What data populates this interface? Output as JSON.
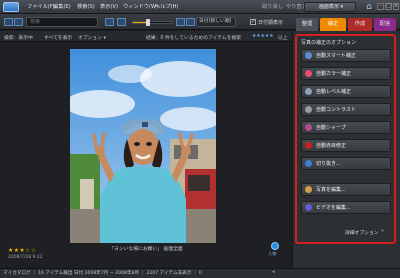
{
  "menu": [
    "ファイル(F)",
    "編集(E)",
    "検索(S)",
    "表示(V)",
    "ウィンドウ(W)",
    "ヘルプ(H)"
  ],
  "undo_label": "取り消し",
  "redo_label": "やり直し",
  "quick_button": "画面表示 ▾",
  "search": {
    "placeholder": "検索"
  },
  "toolbar": {
    "sort_label": "日付(新しい順)",
    "date_checkbox_label": "日付順表示"
  },
  "tabs": [
    "整理",
    "補正",
    "作成",
    "配信"
  ],
  "filter": {
    "search_label": "検索：表示中",
    "show_all": "すべてを表示",
    "options": "オプション ▾",
    "result_text": "結果：0 件をしているためのアイテムを検索",
    "more": "以上"
  },
  "photo": {
    "caption": "「ヨシいな場にお願い」 画面全面"
  },
  "photo_meta": {
    "stars": "★★★☆☆",
    "date": "2008/7/28 9:22"
  },
  "person_label": "人物",
  "panel": {
    "title": "写真の補正のオプション",
    "buttons": [
      {
        "label": "自動スマート補正",
        "icon": "auto-smart-fix-icon",
        "color": "#5a8fd8"
      },
      {
        "label": "自動カラー補正",
        "icon": "auto-color-icon",
        "color": "#e94d6a"
      },
      {
        "label": "自動レベル補正",
        "icon": "auto-levels-icon",
        "color": "#8fa0b8"
      },
      {
        "label": "自動コントラスト",
        "icon": "auto-contrast-icon",
        "color": "#9b9b9b"
      },
      {
        "label": "自動シャープ",
        "icon": "auto-sharpen-icon",
        "color": "#b04d8a"
      },
      {
        "label": "自動赤目修正",
        "icon": "red-eye-icon",
        "color": "#c82020"
      },
      {
        "label": "切り抜き...",
        "icon": "crop-icon",
        "color": "#3a7fcf"
      },
      {
        "label": "写真を編集...",
        "icon": "edit-photo-icon",
        "color": "#d0a040"
      },
      {
        "label": "ビデオを編集...",
        "icon": "edit-video-icon",
        "color": "#6060d0"
      }
    ],
    "detail_options": "詳細オプション",
    "detail_arrow": "»"
  },
  "status": {
    "text": "マイカタログ ｜ 16 アイテム検出 日付 2008年7月 ~ 2008年8月 ｜ 2207 アイテム非表示 ｜ 0",
    "nav": "◂"
  }
}
